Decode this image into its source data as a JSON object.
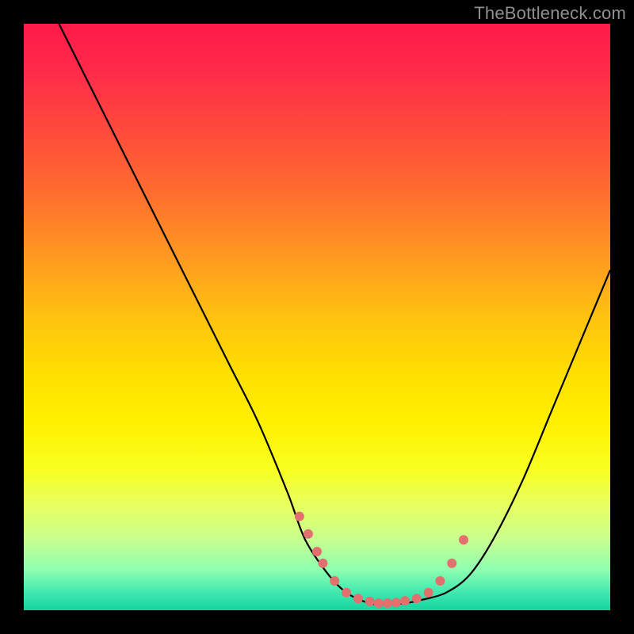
{
  "watermark": "TheBottleneck.com",
  "colors": {
    "curve_stroke": "#000000",
    "dot_fill": "#e2706f",
    "gradient_top": "#ff1a48",
    "gradient_bottom": "#14d4a0",
    "background": "#000000"
  },
  "chart_data": {
    "type": "line",
    "title": "",
    "xlabel": "",
    "ylabel": "",
    "xlim": [
      0,
      100
    ],
    "ylim": [
      0,
      100
    ],
    "curve": {
      "x": [
        6,
        10,
        15,
        20,
        25,
        30,
        35,
        40,
        45,
        48,
        52,
        55,
        58,
        60,
        62,
        65,
        68,
        72,
        76,
        80,
        85,
        90,
        95,
        100
      ],
      "y": [
        100,
        92,
        82,
        72,
        62,
        52,
        42,
        32,
        20,
        12,
        6,
        3,
        1.5,
        1,
        1,
        1.2,
        1.8,
        3,
        6,
        12,
        22,
        34,
        46,
        58
      ]
    },
    "dots": {
      "x": [
        47,
        48.5,
        50,
        51,
        53,
        55,
        57,
        59,
        60.5,
        62,
        63.5,
        65,
        67,
        69,
        71,
        73,
        75
      ],
      "y": [
        16,
        13,
        10,
        8,
        5,
        3,
        2,
        1.5,
        1.2,
        1.2,
        1.3,
        1.6,
        2,
        3,
        5,
        8,
        12
      ]
    },
    "dot_radius": 6
  }
}
